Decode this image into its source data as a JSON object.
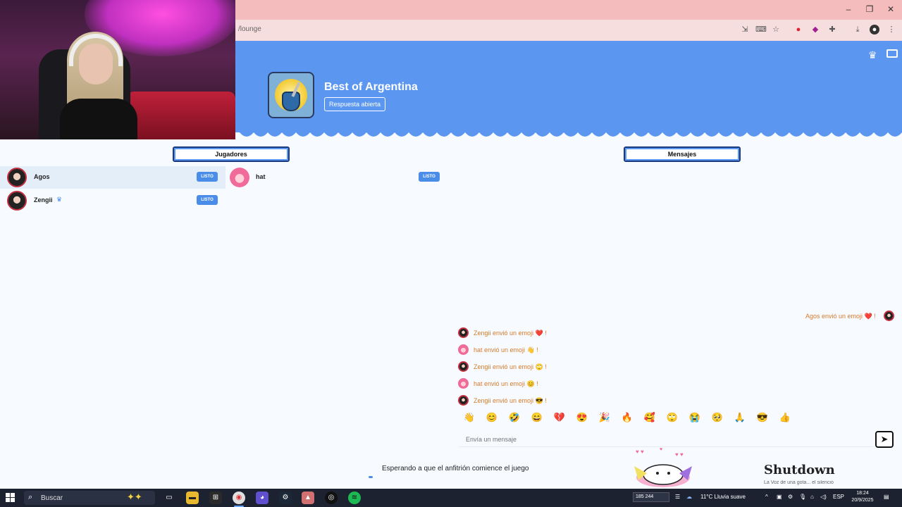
{
  "browser": {
    "url": "/lounge",
    "controls": {
      "minimize": "–",
      "restore": "❐",
      "close": "✕"
    }
  },
  "game": {
    "title": "Best of Argentina",
    "mode": "Respuesta abierta"
  },
  "sections": {
    "players": "Jugadores",
    "messages": "Mensajes"
  },
  "players": [
    {
      "name": "Agos",
      "status": "LISTO"
    },
    {
      "name": "Zengii",
      "status": "LISTO"
    },
    {
      "name": "hat",
      "status": "LISTO"
    }
  ],
  "messages": [
    {
      "text": "Agos envió un emoji ❤️ !"
    },
    {
      "text": "Zengii envió un emoji ❤️ !"
    },
    {
      "text": "hat envió un emoji 👋 !"
    },
    {
      "text": "Zengii envió un emoji 🙄 !"
    },
    {
      "text": "hat envió un emoji 😊 !"
    },
    {
      "text": "Zengii envió un emoji 😎 !"
    }
  ],
  "emojis": [
    "👋",
    "😊",
    "🤣",
    "😄",
    "💔",
    "😍",
    "🎉",
    "🔥",
    "🥰",
    "🙄",
    "😭",
    "🥺",
    "🙏",
    "😎",
    "👍"
  ],
  "input": {
    "placeholder": "Envía un mensaje"
  },
  "status": {
    "waiting": "Esperando a que el anfitrión comience el juego"
  },
  "overlay": {
    "shutdown": "Shutdown",
    "shutdown_sub": "La Voz de una gota... el silencio"
  },
  "taskbar": {
    "search": "Buscar",
    "counter": "185 244",
    "weather": "11°C  Lluvia suave",
    "lang": "ESP",
    "time": "18:24",
    "date": "20/9/2025"
  },
  "colors": {
    "banner": "#5b97f0",
    "ready": "#4a8de8",
    "message": "#d67a2a"
  }
}
